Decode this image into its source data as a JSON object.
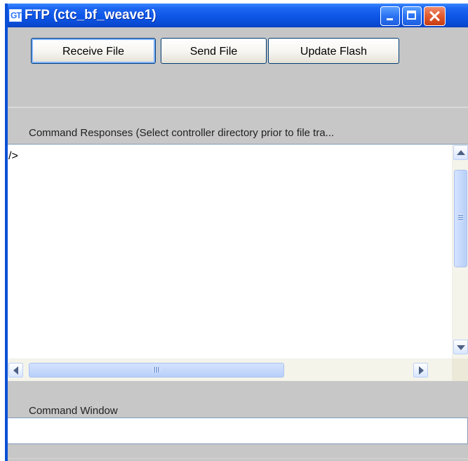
{
  "window": {
    "title": "FTP (ctc_bf_weave1)",
    "icon": {
      "name": "gt-app-icon",
      "text": "GT"
    },
    "buttons": {
      "minimize": "minimize-icon",
      "maximize": "maximize-icon",
      "close": "close-icon"
    }
  },
  "toolbar": {
    "receive_file_label": "Receive File",
    "send_file_label": "Send File",
    "update_flash_label": "Update Flash"
  },
  "command_responses": {
    "label": "Command Responses (Select controller directory prior to file tra...",
    "content": "/>"
  },
  "command_window": {
    "label": "Command Window",
    "value": "",
    "placeholder": ""
  },
  "colors": {
    "titlebar": "#0a4bd5",
    "window_background": "#c7c7c7",
    "content_background": "#ffffff",
    "scroll_thumb": "#b8cff9",
    "close_button": "#e25a2e"
  },
  "scrollbars": {
    "vertical": {
      "up_icon": "chevron-up-icon",
      "down_icon": "chevron-down-icon",
      "thumb_start_fraction": 0.12,
      "thumb_fraction": 0.46
    },
    "horizontal": {
      "left_icon": "chevron-left-icon",
      "right_icon": "chevron-right-icon",
      "thumb_start_fraction": 0.05,
      "thumb_fraction": 0.58
    }
  }
}
